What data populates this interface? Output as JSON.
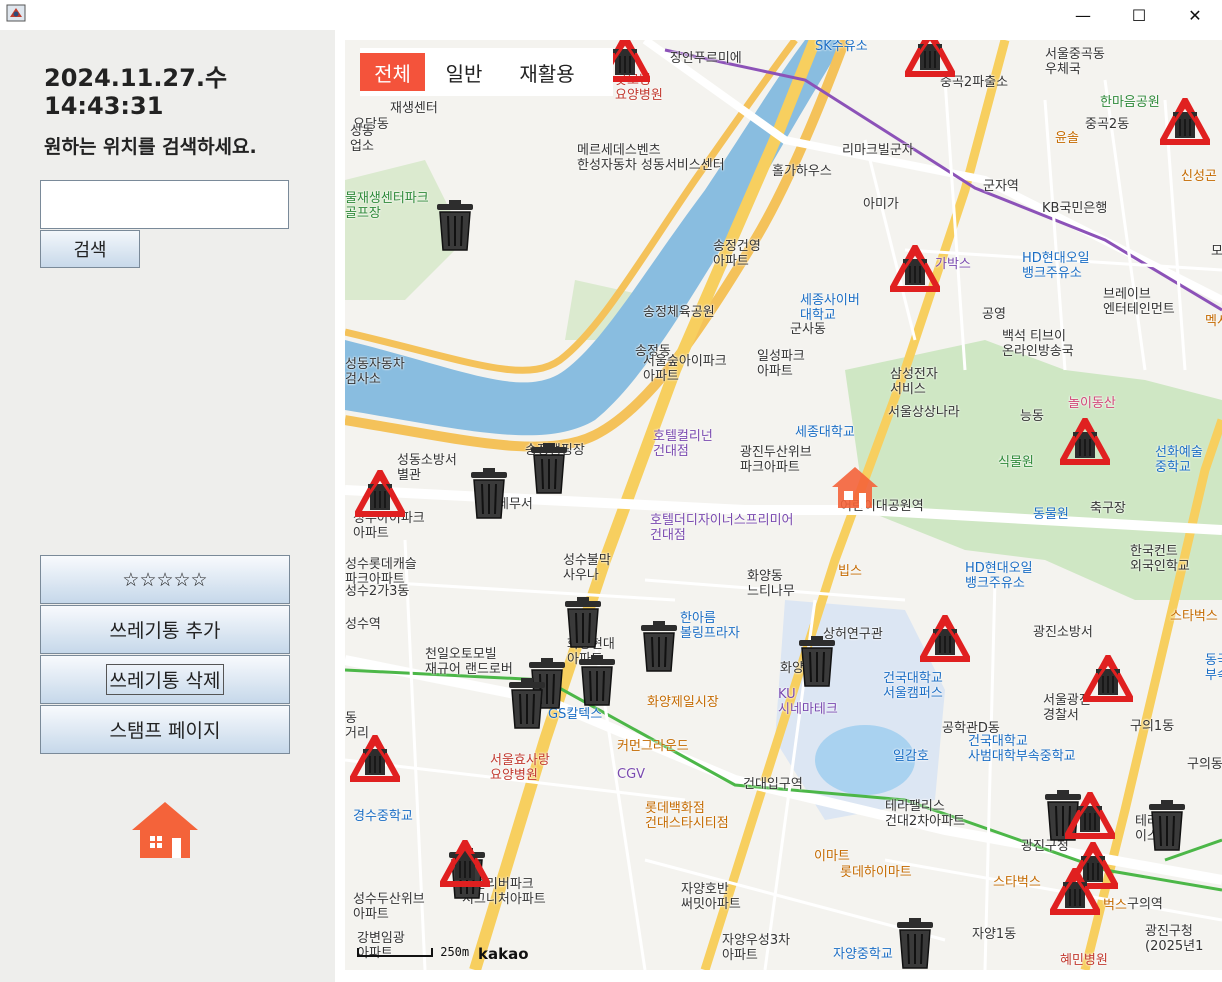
{
  "window": {
    "minimize_glyph": "—",
    "maximize_glyph": "☐",
    "close_glyph": "✕"
  },
  "left": {
    "date": "2024.11.27.수",
    "time": "14:43:31",
    "prompt": "원하는 위치를 검색하세요.",
    "search_value": "",
    "search_button": "검색",
    "buttons": [
      "☆☆☆☆☆",
      "쓰레기통 추가",
      "쓰레기통 삭제",
      "스탬프 페이지"
    ]
  },
  "map": {
    "filters": [
      "전체",
      "일반",
      "재활용"
    ],
    "active_filter": "전체",
    "scale": "250m",
    "attribution": "kakao",
    "colors": {
      "filter_active": "#f4533b",
      "home": "#f4633a",
      "recycle_marker": "#e02020",
      "trash_marker": "#2d2d2d"
    },
    "labels": [
      {
        "text": "SK수유소",
        "cls": "blue"
      },
      {
        "text": "장안푸르미에",
        "cls": ""
      },
      {
        "text": "서울중곡동\n우체국",
        "cls": ""
      },
      {
        "text": "굿모닝\n요양병원",
        "cls": "red"
      },
      {
        "text": "중곡2파출소",
        "cls": ""
      },
      {
        "text": "한마음공원",
        "cls": "green"
      },
      {
        "text": "재생센터",
        "cls": ""
      },
      {
        "text": "중곡2동",
        "cls": ""
      },
      {
        "text": "윤솔",
        "cls": "orange"
      },
      {
        "text": "요당동",
        "cls": ""
      },
      {
        "text": "메르세데스벤츠\n한성자동차 성동서비스센터",
        "cls": ""
      },
      {
        "text": "리마크빌군자",
        "cls": ""
      },
      {
        "text": "성동\n업소",
        "cls": ""
      },
      {
        "text": "홀가하우스",
        "cls": ""
      },
      {
        "text": "신성곤",
        "cls": "orange"
      },
      {
        "text": "군자역",
        "cls": ""
      },
      {
        "text": "KB국민은행",
        "cls": ""
      },
      {
        "text": "아미가",
        "cls": ""
      },
      {
        "text": "물재생센터파크\n골프장",
        "cls": "green"
      },
      {
        "text": "송정건영\n아파트",
        "cls": ""
      },
      {
        "text": "가박스",
        "cls": "purple"
      },
      {
        "text": "HD현대오일\n뱅크주유소",
        "cls": "blue"
      },
      {
        "text": "모",
        "cls": ""
      },
      {
        "text": "공영",
        "cls": ""
      },
      {
        "text": "브레이브\n엔터테인먼트",
        "cls": ""
      },
      {
        "text": "세종사이버\n대학교",
        "cls": "blue"
      },
      {
        "text": "군사동",
        "cls": ""
      },
      {
        "text": "송정체육공원",
        "cls": ""
      },
      {
        "text": "멕시",
        "cls": "orange"
      },
      {
        "text": "백석 티브이\n온라인방송국",
        "cls": ""
      },
      {
        "text": "일성파크\n아파트",
        "cls": ""
      },
      {
        "text": "송정동",
        "cls": ""
      },
      {
        "text": "서울숲아이파크\n아파트",
        "cls": ""
      },
      {
        "text": "성동자동차\n검사소",
        "cls": ""
      },
      {
        "text": "삼성전자\n서비스",
        "cls": ""
      },
      {
        "text": "서울상상나라",
        "cls": ""
      },
      {
        "text": "능동",
        "cls": ""
      },
      {
        "text": "놀이동산",
        "cls": "pink"
      },
      {
        "text": "세종대학교",
        "cls": "blue"
      },
      {
        "text": "호텔컬리넌\n건대점",
        "cls": "purple"
      },
      {
        "text": "송정캠핑장",
        "cls": ""
      },
      {
        "text": "식물원",
        "cls": "green"
      },
      {
        "text": "선화예술\n중학교",
        "cls": "blue"
      },
      {
        "text": "성동소방서\n별관",
        "cls": ""
      },
      {
        "text": "광진두산위브\n파크아파트",
        "cls": ""
      },
      {
        "text": "동물원",
        "cls": "blue"
      },
      {
        "text": "축구장",
        "cls": ""
      },
      {
        "text": "세무서",
        "cls": ""
      },
      {
        "text": "어린이대공원역",
        "cls": ""
      },
      {
        "text": "성수아이파크\n아파트",
        "cls": ""
      },
      {
        "text": "호텔더디자이너스프리미어\n건대점",
        "cls": "purple"
      },
      {
        "text": "한국컨트\n외국인학교",
        "cls": ""
      },
      {
        "text": "성수롯데캐슬\n파크아파트",
        "cls": ""
      },
      {
        "text": "성수불막\n사우나",
        "cls": ""
      },
      {
        "text": "빕스",
        "cls": "orange"
      },
      {
        "text": "성수2가3동",
        "cls": ""
      },
      {
        "text": "화양동\n느티나무",
        "cls": ""
      },
      {
        "text": "HD현대오일\n뱅크주유소",
        "cls": "blue"
      },
      {
        "text": "스타벅스",
        "cls": "orange"
      },
      {
        "text": "성수역",
        "cls": ""
      },
      {
        "text": "한아름\n볼링프라자",
        "cls": "blue"
      },
      {
        "text": "상허연구관",
        "cls": ""
      },
      {
        "text": "광진소방서",
        "cls": ""
      },
      {
        "text": "천일오토모빌\n재규어 랜드로버",
        "cls": ""
      },
      {
        "text": "화양현대\n아파트",
        "cls": ""
      },
      {
        "text": "화양동",
        "cls": ""
      },
      {
        "text": "건국대학교\n서울캠퍼스",
        "cls": "blue"
      },
      {
        "text": "동국\n부속",
        "cls": "blue"
      },
      {
        "text": "서울광진\n경찰서",
        "cls": ""
      },
      {
        "text": "화양제일시장",
        "cls": "orange"
      },
      {
        "text": "동\n거리",
        "cls": ""
      },
      {
        "text": "GS칼텍스",
        "cls": "blue"
      },
      {
        "text": "KU\n시네마테크",
        "cls": "purple"
      },
      {
        "text": "공학관D동",
        "cls": ""
      },
      {
        "text": "구의1동",
        "cls": ""
      },
      {
        "text": "커먼그라운드",
        "cls": "orange"
      },
      {
        "text": "서울효사랑\n요양병원",
        "cls": "red"
      },
      {
        "text": "일감호",
        "cls": "blue"
      },
      {
        "text": "건국대학교\n사범대학부속중학교",
        "cls": "blue"
      },
      {
        "text": "구의동",
        "cls": ""
      },
      {
        "text": "CGV",
        "cls": "purple"
      },
      {
        "text": "건대입구역",
        "cls": ""
      },
      {
        "text": "경수중학교",
        "cls": "blue"
      },
      {
        "text": "롯데백화점\n건대스타시티점",
        "cls": "orange"
      },
      {
        "text": "테라팰리스\n건대2차아파트",
        "cls": ""
      },
      {
        "text": "테라\n이스",
        "cls": ""
      },
      {
        "text": "광진구청",
        "cls": ""
      },
      {
        "text": "이마트",
        "cls": "orange"
      },
      {
        "text": "롯데하이마트",
        "cls": "orange"
      },
      {
        "text": "캐슬리버파크\n시그니처아파트",
        "cls": ""
      },
      {
        "text": "스타벅스",
        "cls": "orange"
      },
      {
        "text": "구의역",
        "cls": ""
      },
      {
        "text": "자양호반\n써밋아파트",
        "cls": ""
      },
      {
        "text": "성수두산위브\n아파트",
        "cls": ""
      },
      {
        "text": "벅스",
        "cls": "orange"
      },
      {
        "text": "자양우성3차\n아파트",
        "cls": ""
      },
      {
        "text": "자양1동",
        "cls": ""
      },
      {
        "text": "광진구청\n(2025년1",
        "cls": ""
      },
      {
        "text": "강변임광\n아파트",
        "cls": ""
      },
      {
        "text": "자양중학교",
        "cls": "blue"
      },
      {
        "text": "혜민병원",
        "cls": "red"
      }
    ]
  }
}
